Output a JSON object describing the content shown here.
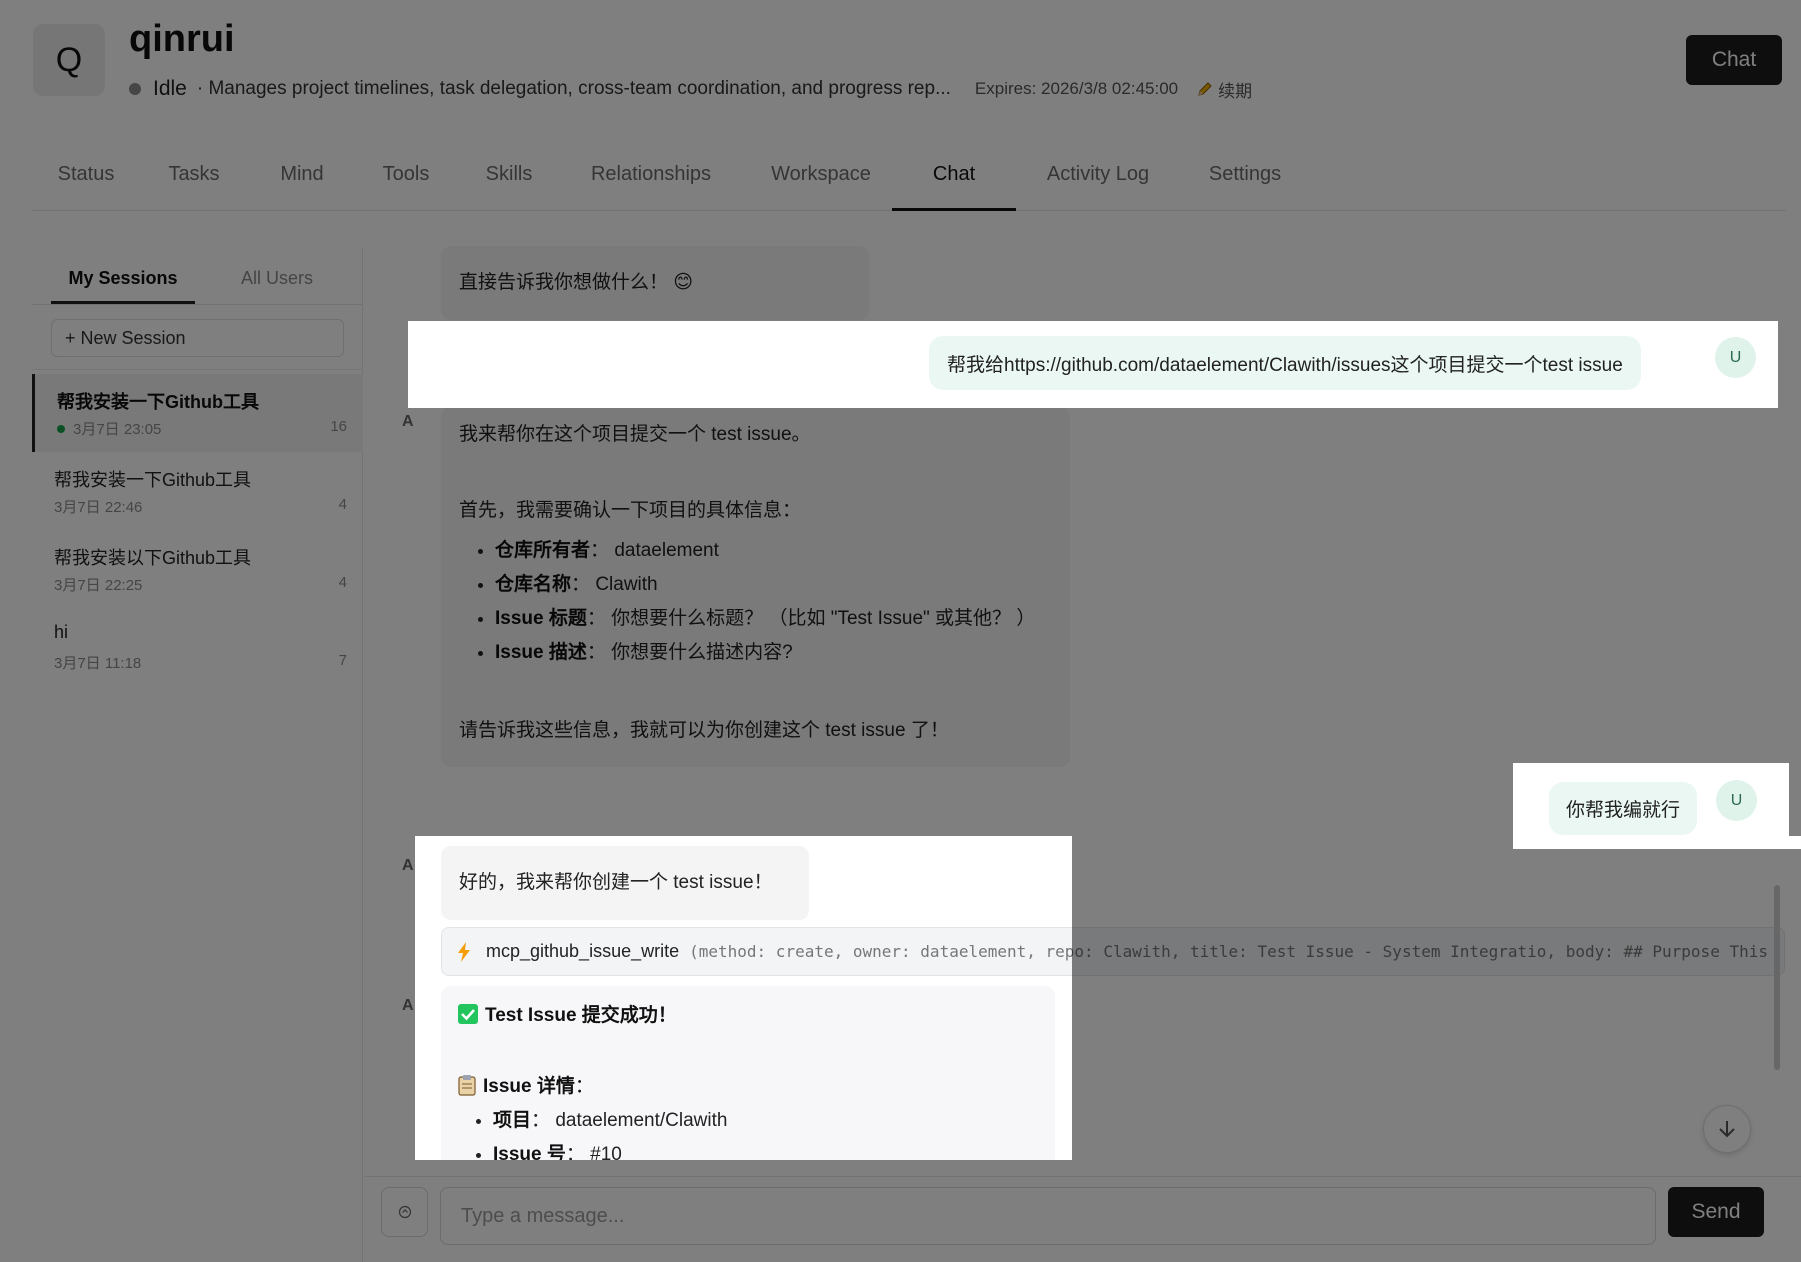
{
  "agent": {
    "initial": "Q",
    "name": "qinrui",
    "status": "Idle",
    "description": "· Manages project timelines, task delegation, cross-team coordination, and progress rep...",
    "expires": "Expires: 2026/3/8 02:45:00",
    "renew_label": "续期",
    "chat_button": "Chat"
  },
  "tabs": [
    {
      "label": "Status"
    },
    {
      "label": "Tasks"
    },
    {
      "label": "Mind"
    },
    {
      "label": "Tools"
    },
    {
      "label": "Skills"
    },
    {
      "label": "Relationships"
    },
    {
      "label": "Workspace"
    },
    {
      "label": "Chat"
    },
    {
      "label": "Activity Log"
    },
    {
      "label": "Settings"
    }
  ],
  "sessions_panel": {
    "tab_mine": "My Sessions",
    "tab_all": "All Users",
    "new_session": "+ New Session",
    "sessions": [
      {
        "title": "帮我安装一下Github工具",
        "time": "3月7日 23:05",
        "count": "16"
      },
      {
        "title": "帮我安装一下Github工具",
        "time": "3月7日 22:46",
        "count": "4"
      },
      {
        "title": "帮我安装以下Github工具",
        "time": "3月7日 22:25",
        "count": "4"
      },
      {
        "title": "hi",
        "time": "3月7日 11:18",
        "count": "7"
      }
    ]
  },
  "chat": {
    "agent_avatar": "A",
    "user_avatar": "U",
    "msg1": "直接告诉我你想做什么！ 😊",
    "user_msg1": "帮我给https://github.com/dataelement/Clawith/issues这个项目提交一个test issue",
    "msg2": {
      "intro": "我来帮你在这个项目提交一个 test issue。",
      "confirm": "首先，我需要确认一下项目的具体信息：",
      "items": [
        {
          "label": "仓库所有者",
          "sep": "：",
          "value": "dataelement"
        },
        {
          "label": "仓库名称",
          "sep": "：",
          "value": "Clawith"
        },
        {
          "label": "Issue 标题",
          "sep": "：",
          "value": "你想要什么标题？ （比如 \"Test Issue\" 或其他？ ）"
        },
        {
          "label": "Issue 描述",
          "sep": "：",
          "value": "你想要什么描述内容?"
        }
      ],
      "closing": "请告诉我这些信息，我就可以为你创建这个 test issue 了！"
    },
    "user_msg2": "你帮我编就行",
    "msg3": "好的，我来帮你创建一个 test issue！",
    "tool_call": {
      "name": "mcp_github_issue_write",
      "args": "(method: create, owner: dataelement, repo: Clawith, title: Test Issue - System Integratio, body: ## Purpose This"
    },
    "msg4": {
      "title": "Test Issue 提交成功！",
      "details_title": "Issue 详情",
      "details_sep": "：",
      "items": [
        {
          "label": "项目",
          "sep": "：",
          "value": "dataelement/Clawith"
        },
        {
          "label": "Issue 号",
          "sep": "：",
          "value": "#10"
        }
      ]
    },
    "input_placeholder": "Type a message...",
    "send_button": "Send"
  }
}
